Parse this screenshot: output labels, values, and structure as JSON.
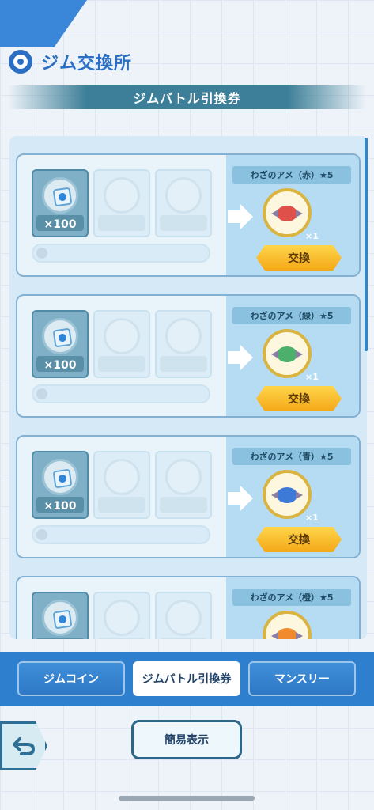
{
  "header": {
    "title": "ジム交換所",
    "section_title": "ジムバトル引換券"
  },
  "colors": {
    "primary_blue": "#2f7fcf",
    "accent_gold": "#f4a818",
    "candy_red": "#e0504a",
    "candy_green": "#4caf6a",
    "candy_blue": "#3d7ad8",
    "candy_orange": "#f08a2c"
  },
  "cards": [
    {
      "cost_qty": "×100",
      "reward_label": "わざのアメ（赤）★5",
      "reward_qty": "×1",
      "exchange_label": "交換",
      "candy_color": "#e0504a"
    },
    {
      "cost_qty": "×100",
      "reward_label": "わざのアメ（緑）★5",
      "reward_qty": "×1",
      "exchange_label": "交換",
      "candy_color": "#4caf6a"
    },
    {
      "cost_qty": "×100",
      "reward_label": "わざのアメ（青）★5",
      "reward_qty": "×1",
      "exchange_label": "交換",
      "candy_color": "#3d7ad8"
    },
    {
      "cost_qty": "",
      "reward_label": "わざのアメ（橙）★5",
      "reward_qty": "",
      "exchange_label": "",
      "candy_color": "#f08a2c"
    }
  ],
  "tabs": [
    {
      "label": "ジムコイン",
      "active": false
    },
    {
      "label": "ジムバトル引換券",
      "active": true
    },
    {
      "label": "マンスリー",
      "active": false
    }
  ],
  "footer": {
    "simple_view_label": "簡易表示",
    "back_icon": "back-arrow-icon"
  }
}
